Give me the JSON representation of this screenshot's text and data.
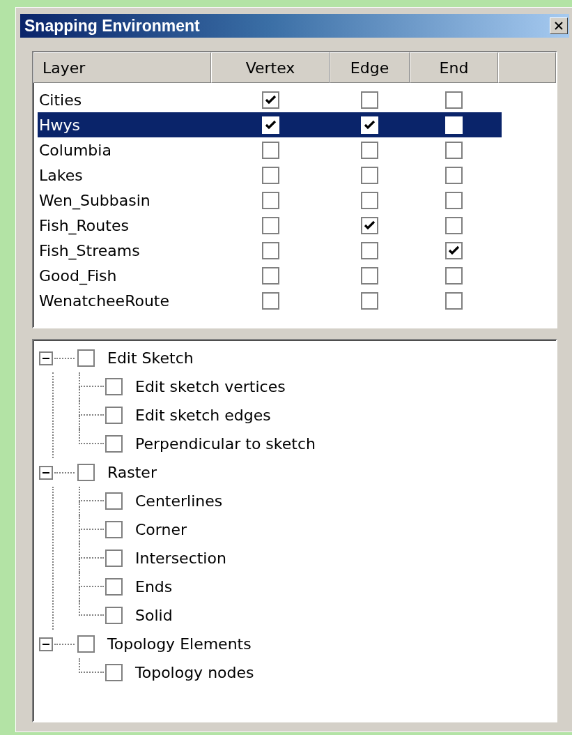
{
  "window": {
    "title": "Snapping Environment"
  },
  "table": {
    "columns": [
      "Layer",
      "Vertex",
      "Edge",
      "End"
    ],
    "rows": [
      {
        "layer": "Cities",
        "vertex": true,
        "edge": false,
        "end": false,
        "selected": false
      },
      {
        "layer": "Hwys",
        "vertex": true,
        "edge": true,
        "end": false,
        "selected": true
      },
      {
        "layer": "Columbia",
        "vertex": false,
        "edge": false,
        "end": false,
        "selected": false
      },
      {
        "layer": "Lakes",
        "vertex": false,
        "edge": false,
        "end": false,
        "selected": false
      },
      {
        "layer": "Wen_Subbasin",
        "vertex": false,
        "edge": false,
        "end": false,
        "selected": false
      },
      {
        "layer": "Fish_Routes",
        "vertex": false,
        "edge": true,
        "end": false,
        "selected": false
      },
      {
        "layer": "Fish_Streams",
        "vertex": false,
        "edge": false,
        "end": true,
        "selected": false
      },
      {
        "layer": "Good_Fish",
        "vertex": false,
        "edge": false,
        "end": false,
        "selected": false
      },
      {
        "layer": "WenatcheeRoute",
        "vertex": false,
        "edge": false,
        "end": false,
        "selected": false
      }
    ]
  },
  "tree": [
    {
      "label": "Edit Sketch",
      "checked": false,
      "expanded": true,
      "children": [
        {
          "label": "Edit sketch vertices",
          "checked": false
        },
        {
          "label": "Edit sketch edges",
          "checked": false
        },
        {
          "label": "Perpendicular to sketch",
          "checked": false
        }
      ]
    },
    {
      "label": "Raster",
      "checked": false,
      "expanded": true,
      "children": [
        {
          "label": "Centerlines",
          "checked": false
        },
        {
          "label": "Corner",
          "checked": false
        },
        {
          "label": "Intersection",
          "checked": false
        },
        {
          "label": "Ends",
          "checked": false
        },
        {
          "label": "Solid",
          "checked": false
        }
      ]
    },
    {
      "label": "Topology Elements",
      "checked": false,
      "expanded": true,
      "children": [
        {
          "label": "Topology nodes",
          "checked": false
        }
      ]
    }
  ]
}
